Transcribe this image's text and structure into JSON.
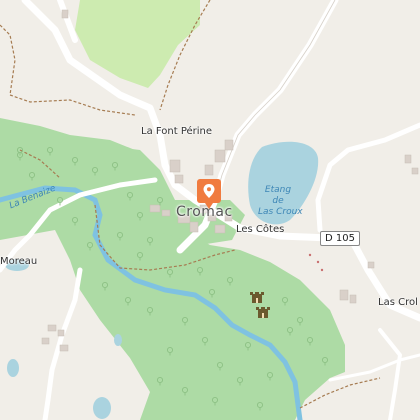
{
  "map": {
    "labels": {
      "la_font_perine": "La Font Périne",
      "cromac": "Cromac",
      "les_cotes": "Les Côtes",
      "moreau": "Moreau",
      "las_crol": "Las Crol",
      "river": "La Benaize",
      "lake_line1": "Etang",
      "lake_line2": "de",
      "lake_line3": "Las Croux"
    },
    "road_shield": "D 105",
    "marker": {
      "icon": "location-pin-icon",
      "color": "#f07b3f"
    },
    "colors": {
      "background": "#f1eee8",
      "forest": "#addba5",
      "meadow": "#cdebb0",
      "water": "#aad3df",
      "river": "#7fc2e1",
      "road": "#ffffff",
      "track": "#a67c52",
      "building": "#d9d0c9"
    },
    "icons": [
      "location-pin-icon",
      "castle-icon",
      "tree-icon"
    ]
  }
}
